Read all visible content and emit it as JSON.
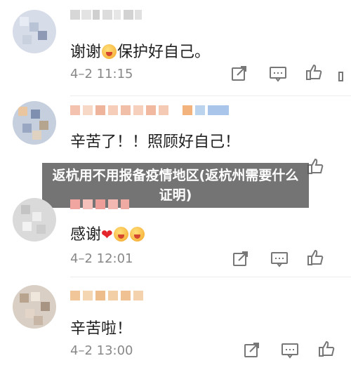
{
  "comments": [
    {
      "text": "谢谢",
      "text_after_emoji": "保护好自己。",
      "time": "4–2 11:15"
    },
    {
      "text": "辛苦了！！照顾好自己！",
      "time": ""
    },
    {
      "text": "感谢",
      "time": "4–2 12:01"
    },
    {
      "text": "辛苦啦！",
      "time": "4–2 13:00"
    }
  ],
  "overlay": {
    "title": "返杭用不用报备疫情地区(返杭州需要什么证明)"
  },
  "icons": [
    "share-icon",
    "comment-icon",
    "like-icon"
  ],
  "colors": {
    "text": "#1e1e1e",
    "time": "#888888",
    "icon": "#777777",
    "overlay": "#555555",
    "heart": "#e4252b"
  }
}
